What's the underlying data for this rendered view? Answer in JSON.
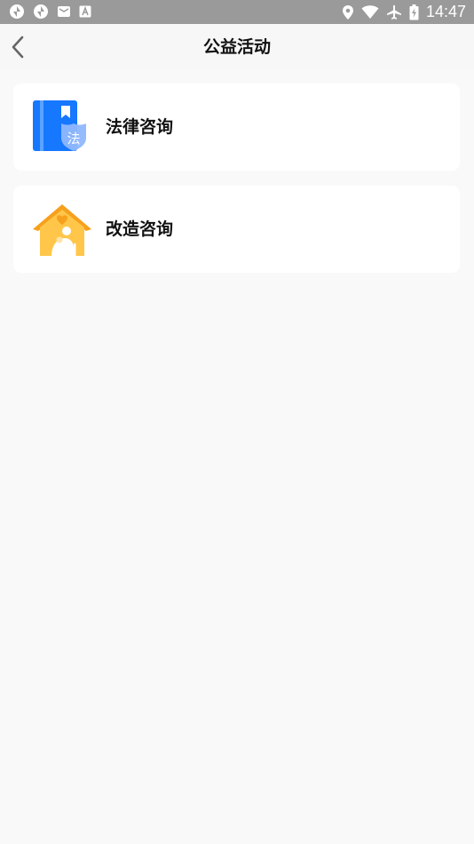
{
  "status_bar": {
    "time": "14:47",
    "left_icons": [
      "sync-icon",
      "sync-icon",
      "mail-icon",
      "text-a-icon"
    ],
    "right_icons": [
      "location-icon",
      "wifi-icon",
      "airplane-mode-icon",
      "battery-charging-icon"
    ]
  },
  "header": {
    "title": "公益活动",
    "back_icon": "chevron-left-icon"
  },
  "items": [
    {
      "label": "法律咨询",
      "icon": "law-book-icon",
      "icon_text": "法",
      "accent": "#1677ff"
    },
    {
      "label": "改造咨询",
      "icon": "home-elder-icon",
      "accent": "#f7a01c"
    }
  ],
  "colors": {
    "status_bar": "#9a9a9a",
    "page_bg": "#f9f9f9",
    "card_bg": "#ffffff",
    "title_text": "#111111"
  }
}
